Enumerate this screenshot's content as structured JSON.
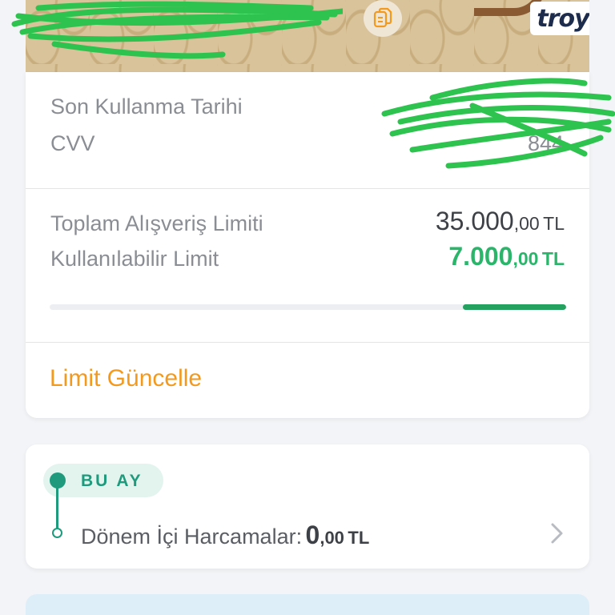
{
  "card": {
    "brand": "troy",
    "copy_icon": "copy-icon"
  },
  "details": {
    "expiry_label": "Son Kullanma Tarihi",
    "cvv_label": "CVV",
    "cvv_value": "844"
  },
  "limits": {
    "total_label": "Toplam Alışveriş Limiti",
    "total_main": "35.000",
    "total_decimal": ",00",
    "total_currency": "TL",
    "available_label": "Kullanılabilir Limit",
    "available_main": "7.000",
    "available_decimal": ",00",
    "available_currency": "TL",
    "available_fraction": 0.2,
    "update_link": "Limit Güncelle"
  },
  "period": {
    "chip_label": "BU AY",
    "spend_label": "Dönem İçi Harcamalar:",
    "spend_main": "0",
    "spend_decimal": ",00",
    "spend_currency": "TL",
    "chevron_icon": "chevron-right-icon"
  },
  "colors": {
    "accent_green": "#2bb56b",
    "accent_orange": "#f39a1e",
    "teal": "#1f9a7c",
    "scribble_green": "#2ec34f"
  }
}
